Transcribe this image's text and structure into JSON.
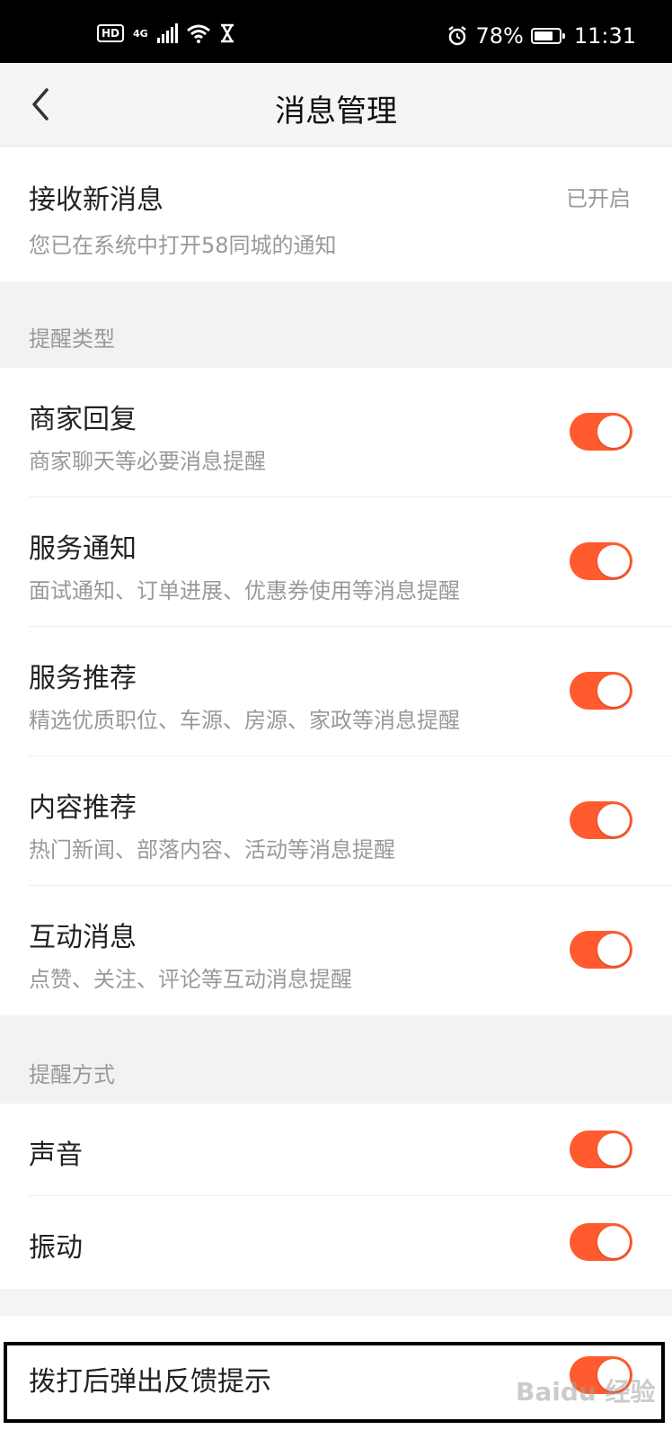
{
  "status_bar": {
    "left": {
      "hd": "HD",
      "network": "4G"
    },
    "battery_percent": "78%",
    "battery_level": 0.78,
    "time": "11:31"
  },
  "header": {
    "title": "消息管理"
  },
  "receive": {
    "title": "接收新消息",
    "desc": "您已在系统中打开58同城的通知",
    "value": "已开启"
  },
  "reminder_types": {
    "label": "提醒类型",
    "items": [
      {
        "title": "商家回复",
        "desc": "商家聊天等必要消息提醒",
        "on": true
      },
      {
        "title": "服务通知",
        "desc": "面试通知、订单进展、优惠券使用等消息提醒",
        "on": true
      },
      {
        "title": "服务推荐",
        "desc": "精选优质职位、车源、房源、家政等消息提醒",
        "on": true
      },
      {
        "title": "内容推荐",
        "desc": "热门新闻、部落内容、活动等消息提醒",
        "on": true
      },
      {
        "title": "互动消息",
        "desc": "点赞、关注、评论等互动消息提醒",
        "on": true
      }
    ]
  },
  "reminder_methods": {
    "label": "提醒方式",
    "items": [
      {
        "title": "声音",
        "on": true
      },
      {
        "title": "振动",
        "on": true
      }
    ]
  },
  "feedback": {
    "title": "拨打后弹出反馈提示",
    "on": true
  },
  "watermark": "Baidu 经验",
  "colors": {
    "accent": "#ff5b2e",
    "background": "#f4f4f4"
  }
}
